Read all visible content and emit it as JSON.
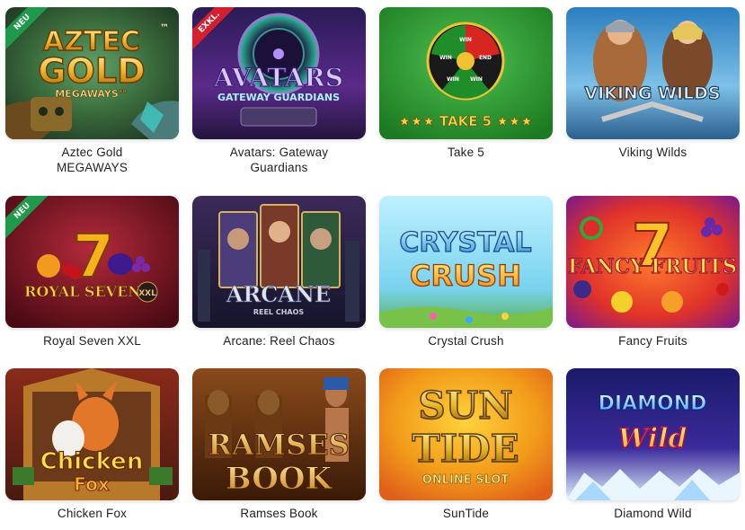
{
  "games": [
    {
      "title": "Aztec Gold MEGAWAYS",
      "badge": "NEU",
      "logo_lines": [
        "AZTEC",
        "GOLD",
        "MEGAWAYS™"
      ],
      "tm": "™"
    },
    {
      "title": "Avatars: Gateway Guardians",
      "badge": "EXKL.",
      "logo_lines": [
        "AVATARS",
        "GATEWAY GUARDIANS"
      ]
    },
    {
      "title": "Take 5",
      "logo_lines": [
        "★★★ TAKE 5 ★★★"
      ],
      "wheel_labels": [
        "WIN",
        "END",
        "WIN",
        "WIN",
        "WIN"
      ]
    },
    {
      "title": "Viking Wilds",
      "logo_lines": [
        "VIKING WILDS"
      ]
    },
    {
      "title": "Royal Seven XXL",
      "badge": "NEU",
      "logo_lines": [
        "ROYAL SEVEN",
        "XXL"
      ],
      "big_symbol": "7"
    },
    {
      "title": "Arcane: Reel Chaos",
      "logo_lines": [
        "ARCANE",
        "REEL CHAOS"
      ]
    },
    {
      "title": "Crystal Crush",
      "logo_lines": [
        "CRYSTAL",
        "CRUSH"
      ]
    },
    {
      "title": "Fancy Fruits",
      "logo_lines": [
        "FANCY FRUITS"
      ],
      "big_symbol": "7"
    },
    {
      "title": "Chicken Fox",
      "logo_lines": [
        "Chicken",
        "Fox"
      ]
    },
    {
      "title": "Ramses Book",
      "logo_lines": [
        "RAMSES",
        "BOOK"
      ]
    },
    {
      "title": "SunTide",
      "logo_lines": [
        "SUN",
        "TIDE",
        "ONLINE SLOT"
      ]
    },
    {
      "title": "Diamond Wild",
      "logo_lines": [
        "DIAMOND",
        "Wild"
      ]
    }
  ],
  "colors": {
    "new_badge": "#1f9a4a",
    "exclusive_badge": "#d4202e",
    "label_text": "#222222"
  }
}
